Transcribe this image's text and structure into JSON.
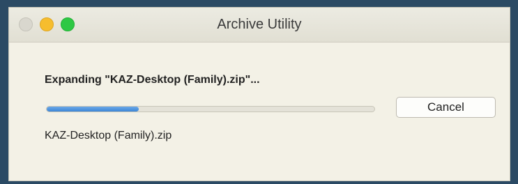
{
  "window": {
    "title": "Archive Utility"
  },
  "main": {
    "heading": "Expanding \"KAZ-Desktop (Family).zip\"...",
    "progress_fraction": 0.28,
    "cancel_label": "Cancel",
    "filename": "KAZ-Desktop (Family).zip"
  },
  "colors": {
    "progress_fill": "#3c86d6",
    "close_button": "#d9d7ce",
    "minimize_button": "#f6bd2e",
    "zoom_button": "#2ec844",
    "window_background": "#f3f1e6"
  }
}
